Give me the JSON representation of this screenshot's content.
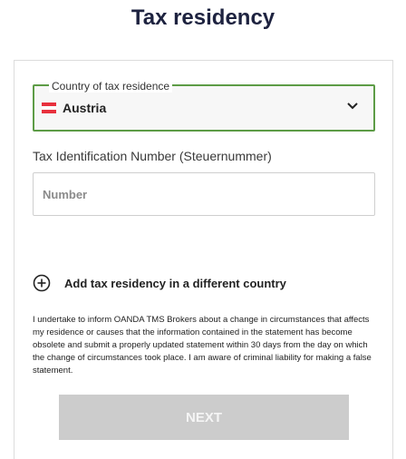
{
  "page": {
    "title": "Tax residency"
  },
  "country_select": {
    "label": "Country of tax residence",
    "value": "Austria",
    "flag": "austria-flag",
    "flag_colors": [
      "#e8303d",
      "#ffffff",
      "#e8303d"
    ],
    "icon": "chevron-down-icon"
  },
  "tin": {
    "label": "Tax Identification Number (Steuernummer)",
    "value": "",
    "placeholder": "Number"
  },
  "add_residency": {
    "icon": "plus-circle-icon",
    "label": "Add tax residency in a different country"
  },
  "statement": "I undertake to inform OANDA TMS Brokers about a change in circumstances that affects my residence or causes that the information contained in the statement has become obsolete and submit a properly updated statement within 30 days from the day on which the change of circumstances took place. I am aware of criminal liability for making a false statement.",
  "next_button": {
    "label": "NEXT",
    "state": "disabled"
  },
  "colors": {
    "heading": "#1e2340",
    "select_focus_border": "#5d9c46",
    "button_disabled_bg": "#cccccc"
  }
}
